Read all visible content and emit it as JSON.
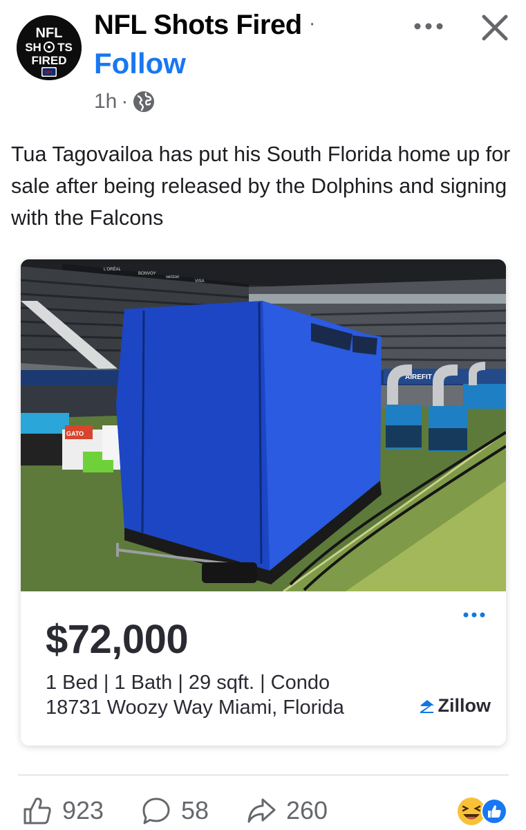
{
  "header": {
    "page_name": "NFL Shots Fired",
    "name_dot": "·",
    "follow_label": "Follow",
    "time": "1h",
    "time_dot": "·",
    "privacy_icon": "globe-icon"
  },
  "avatar": {
    "line1": "NFL",
    "line2": "SH",
    "line2b": "TS",
    "line3": "FIRED",
    "badge": "NFL"
  },
  "post": {
    "text": "Tua Tagovailoa has put his South Florida home up for sale after being released by the Dolphins and signing with the Falcons"
  },
  "listing": {
    "price": "$72,000",
    "details": "1 Bed | 1 Bath | 29 sqft. | Condo",
    "address": "18731 Woozy Way Miami, Florida",
    "brand": "Zillow",
    "photo_signs": [
      "L'ORÉAL",
      "BONVOY",
      "verizon",
      "VISA",
      "GATO",
      "AIREFIT"
    ]
  },
  "actions": {
    "likes": "923",
    "comments": "58",
    "shares": "260"
  },
  "colors": {
    "accent": "#1877f2",
    "text": "#050505",
    "muted": "#65676b",
    "tent_blue": "#1f4fd6",
    "turf": "#5d7a3a"
  }
}
